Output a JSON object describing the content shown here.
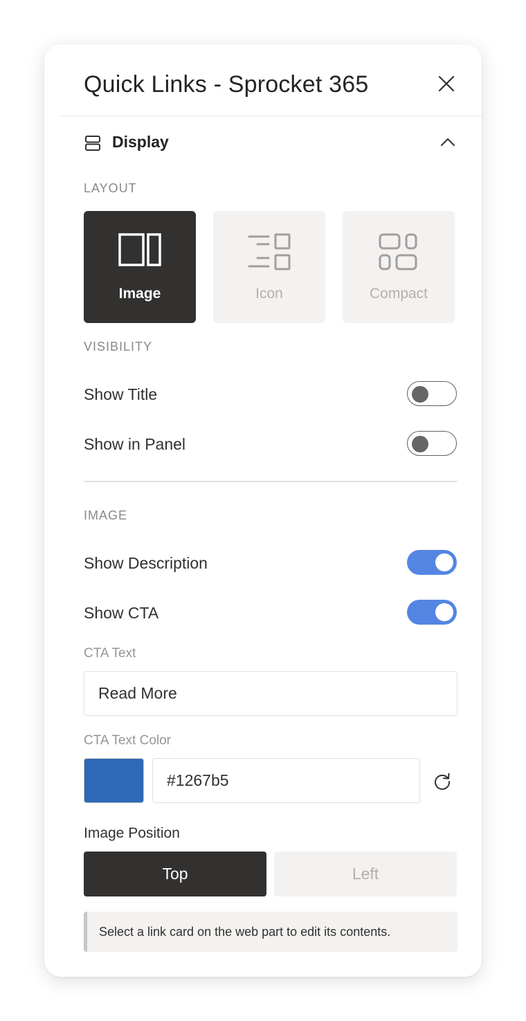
{
  "dialog": {
    "title": "Quick Links - Sprocket 365",
    "close_icon": "close-icon"
  },
  "display_section": {
    "icon": "layout-rows-icon",
    "title": "Display",
    "expanded": true,
    "chevron_icon": "chevron-up-icon"
  },
  "layout": {
    "caption": "Layout",
    "options": [
      {
        "label": "Image",
        "icon": "image-layout-icon",
        "selected": true
      },
      {
        "label": "Icon",
        "icon": "icon-layout-icon",
        "selected": false
      },
      {
        "label": "Compact",
        "icon": "compact-layout-icon",
        "selected": false
      }
    ]
  },
  "visibility": {
    "caption": "Visibility",
    "show_title": {
      "label": "Show Title",
      "on": false
    },
    "show_in_panel": {
      "label": "Show in Panel",
      "on": false
    }
  },
  "image": {
    "caption": "Image",
    "show_description": {
      "label": "Show Description",
      "on": true
    },
    "show_cta": {
      "label": "Show CTA",
      "on": true
    },
    "cta_text": {
      "label": "CTA Text",
      "value": "Read More"
    },
    "cta_text_color": {
      "label": "CTA Text Color",
      "value": "#1267b5",
      "swatch": "#3068b8",
      "reset_icon": "refresh-icon"
    },
    "image_position": {
      "label": "Image Position",
      "options": [
        {
          "label": "Top",
          "selected": true
        },
        {
          "label": "Left",
          "selected": false
        }
      ]
    }
  },
  "info_note": "Select a link card on the web part to edit its contents.",
  "colors": {
    "toggle_on": "#5485e3",
    "selected_dark": "#323130",
    "unselected_bg": "#f3f2f1"
  }
}
